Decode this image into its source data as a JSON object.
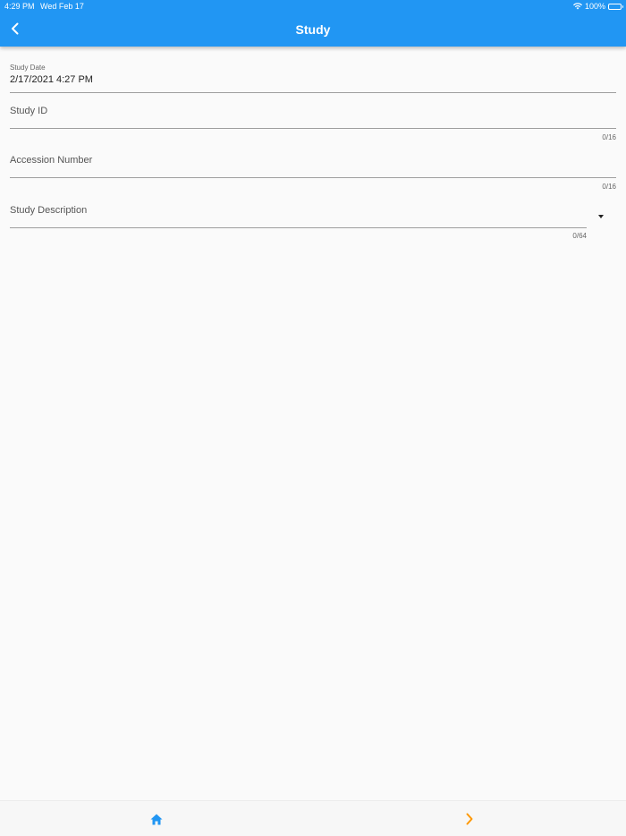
{
  "status_bar": {
    "time": "4:29 PM",
    "date": "Wed Feb 17",
    "battery": "100%",
    "icons": [
      "wifi-icon",
      "battery-icon"
    ]
  },
  "app_bar": {
    "title": "Study",
    "back_icon": "chevron-left-icon",
    "color": "#2196f3"
  },
  "form": {
    "study_date": {
      "label": "Study Date",
      "value": "2/17/2021 4:27 PM"
    },
    "study_id": {
      "label": "Study ID",
      "value": "",
      "counter": "0/16"
    },
    "accession_number": {
      "label": "Accession Number",
      "value": "",
      "counter": "0/16"
    },
    "study_description": {
      "label": "Study Description",
      "value": "",
      "counter": "0/64",
      "icon": "dropdown-arrow-icon"
    }
  },
  "bottom_bar": {
    "home_icon": "home-icon",
    "next_icon": "chevron-right-icon",
    "home_color": "#2196f3",
    "next_color": "#ff9800"
  }
}
